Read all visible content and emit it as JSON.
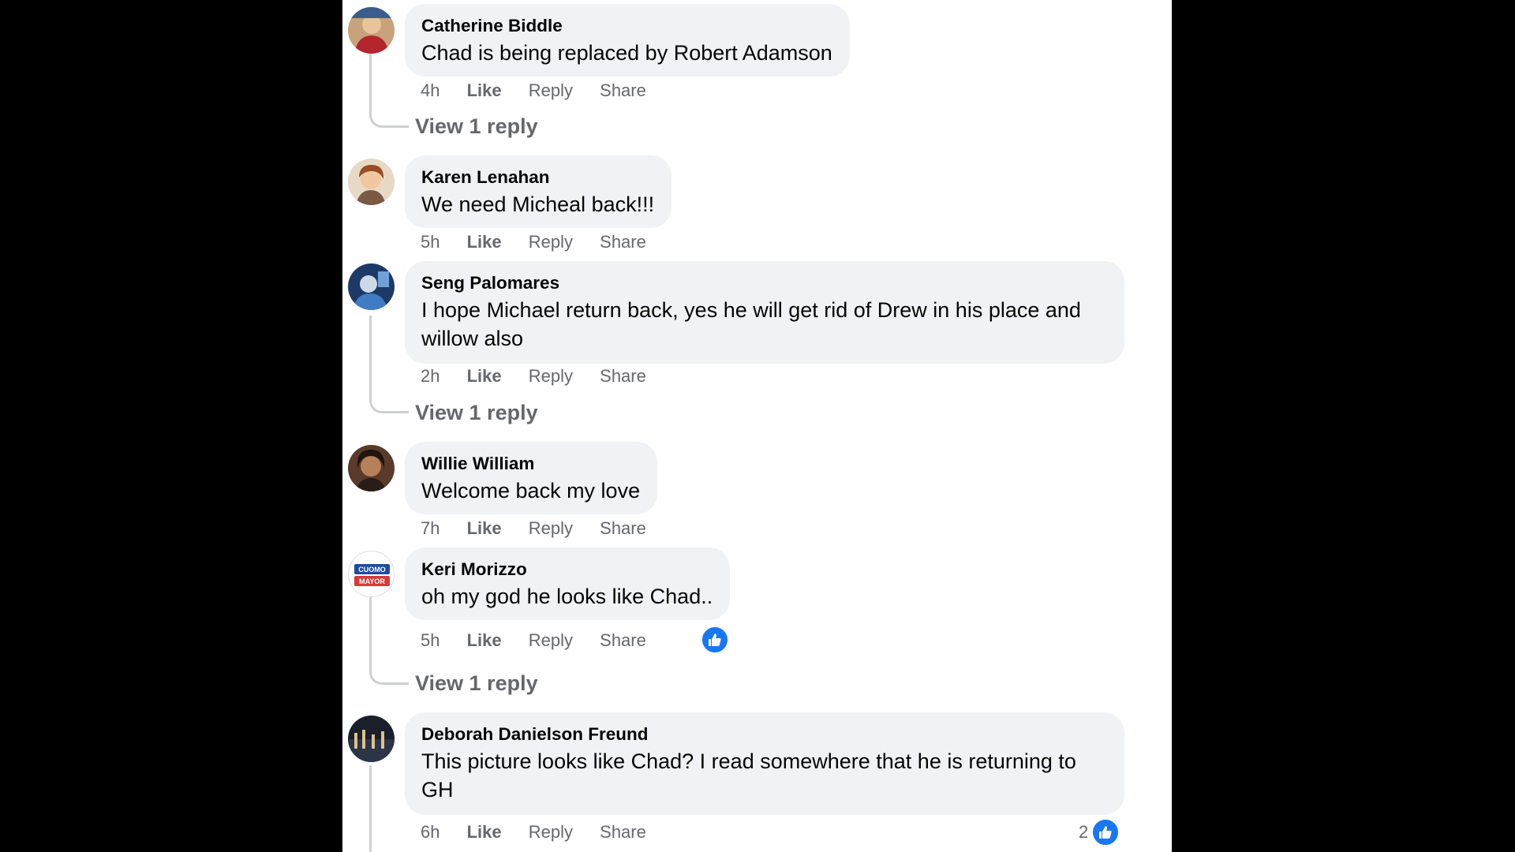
{
  "colors": {
    "bubble": "#f0f2f5",
    "secondary_text": "#65676b",
    "primary_text": "#050505",
    "like_blue": "#1877f2",
    "thread_line": "#ced0d4"
  },
  "action_labels": {
    "like": "Like",
    "reply": "Reply",
    "share": "Share"
  },
  "comments": [
    {
      "author": "Catherine Biddle",
      "text": "Chad is being replaced by Robert Adamson",
      "time": "4h",
      "view_replies": "View 1 reply",
      "avatar_icon": "avatar-photo"
    },
    {
      "author": "Karen Lenahan",
      "text": "We need Micheal back!!!",
      "time": "5h",
      "avatar_icon": "avatar-photo"
    },
    {
      "author": "Seng Palomares",
      "text": "I hope Michael return back, yes he will get rid of Drew in his place and willow also",
      "time": "2h",
      "view_replies": "View 1 reply",
      "avatar_icon": "avatar-photo"
    },
    {
      "author": "Willie William",
      "text": "Welcome back my love",
      "time": "7h",
      "avatar_icon": "avatar-photo"
    },
    {
      "author": "Keri Morizzo",
      "text": "oh my god he looks like Chad..",
      "time": "5h",
      "view_replies": "View 1 reply",
      "reaction_icon": "thumbs-up-icon",
      "avatar_icon": "avatar-badge",
      "avatar_badge_top": "CUOMO",
      "avatar_badge_bottom": "MAYOR"
    },
    {
      "author": "Deborah Danielson Freund",
      "text": "This picture looks like Chad? I read somewhere that he is returning to GH",
      "time": "6h",
      "reaction_icon": "thumbs-up-icon",
      "reaction_count": "2",
      "avatar_icon": "avatar-photo"
    }
  ]
}
